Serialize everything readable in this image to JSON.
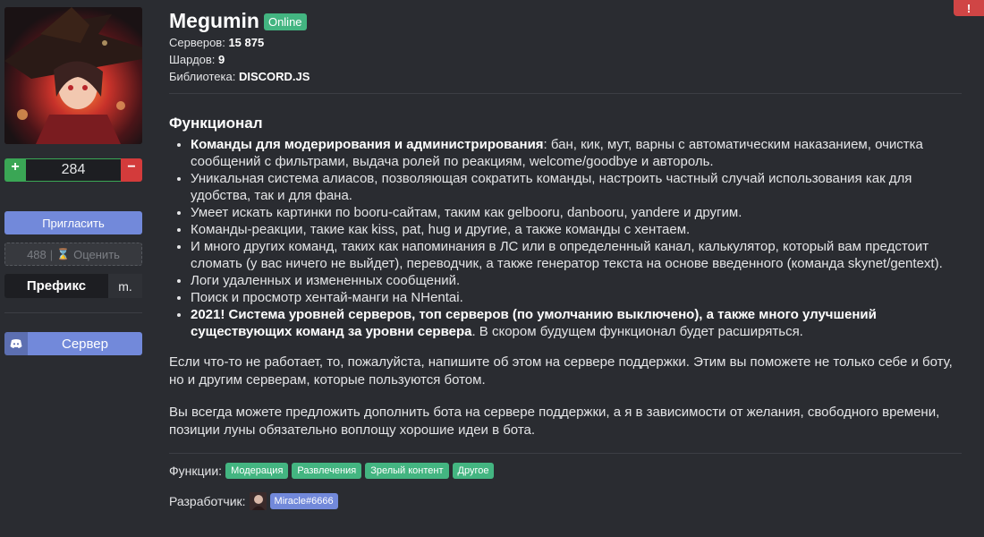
{
  "sidebar": {
    "votes": {
      "plus": "+",
      "count": "284",
      "minus": "−"
    },
    "invite_label": "Пригласить",
    "rate": {
      "count": "488",
      "separator": "|",
      "label": "Оценить"
    },
    "prefix": {
      "label": "Префикс",
      "value": "m."
    },
    "server_label": "Сервер"
  },
  "header": {
    "name": "Megumin",
    "status": "Online",
    "stats": [
      {
        "label": "Серверов:",
        "value": "15 875"
      },
      {
        "label": "Шардов:",
        "value": "9"
      },
      {
        "label": "Библиотека:",
        "value": "DISCORD.JS"
      }
    ]
  },
  "content": {
    "section_title": "Функционал",
    "features": [
      {
        "bold": "Команды для модерирования и администрирования",
        "text": ": бан, кик, мут, варны с автоматическим наказанием, очистка сообщений с фильтрами, выдача ролей по реакциям, welcome/goodbye и автороль."
      },
      {
        "bold": "",
        "text": "Уникальная система алиасов, позволяющая сократить команды, настроить частный случай использования как для удобства, так и для фана."
      },
      {
        "bold": "",
        "text": "Умеет искать картинки по booru-сайтам, таким как gelbooru, danbooru, yandere и другим."
      },
      {
        "bold": "",
        "text": "Команды-реакции, такие как kiss, pat, hug и другие, а также команды с хентаем."
      },
      {
        "bold": "",
        "text": "И много других команд, таких как напоминания в ЛС или в определенный канал, калькулятор, который вам предстоит сломать (у вас ничего не выйдет), переводчик, а также генератор текста на основе введенного (команда skynet/gentext)."
      },
      {
        "bold": "",
        "text": "Логи удаленных и измененных сообщений."
      },
      {
        "bold": "",
        "text": "Поиск и просмотр хентай-манги на NHentai."
      },
      {
        "bold": "2021! Система уровней серверов, топ серверов (по умолчанию выключено), а также много улучшений существующих команд за уровни сервера",
        "text": ". В скором будущем функционал будет расширяться."
      }
    ],
    "paragraph1": "Если что-то не работает, то, пожалуйста, напишите об этом на сервере поддержки. Этим вы поможете не только себе и боту, но и другим серверам, которые пользуются ботом.",
    "paragraph2": "Вы всегда можете предложить дополнить бота на сервере поддержки, а я в зависимости от желания, свободного времени, позиции луны обязательно воплощу хорошие идеи в бота.",
    "functions_label": "Функции:",
    "tags": [
      "Модерация",
      "Развлечения",
      "Зрелый контент",
      "Другое"
    ],
    "developer_label": "Разработчик:",
    "developer": "Miracle#6666"
  },
  "alert": "!",
  "colors": {
    "background": "#2a2c31",
    "accent": "#7289da",
    "online": "#43b581",
    "danger": "#d33b3b"
  }
}
